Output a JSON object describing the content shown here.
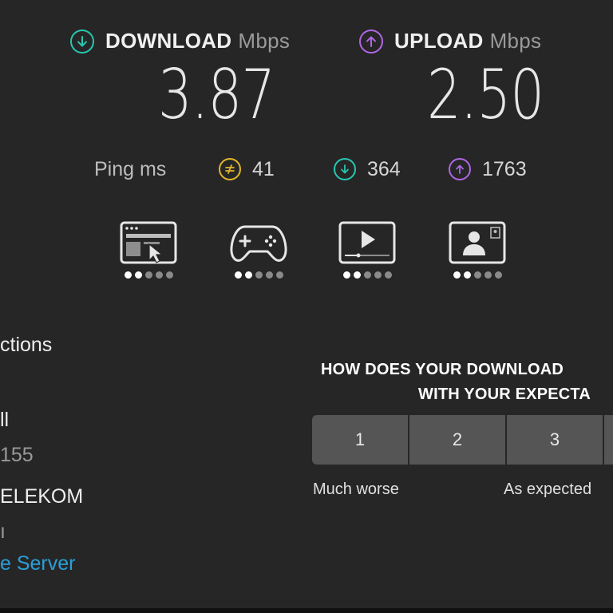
{
  "colors": {
    "download": "#27c6b0",
    "upload": "#b066e6",
    "idle": "#e2b628",
    "link": "#2a9fd8"
  },
  "download": {
    "title": "DOWNLOAD",
    "unit": "Mbps",
    "value": "3.87",
    "icon": "arrow-down-circle-icon"
  },
  "upload": {
    "title": "UPLOAD",
    "unit": "Mbps",
    "value": "2.50",
    "icon": "arrow-up-circle-icon"
  },
  "ping": {
    "label": "Ping ms",
    "idle": "41",
    "download": "364",
    "upload": "1763"
  },
  "usage": [
    {
      "name": "web-browsing",
      "icon": "browser-cursor-icon",
      "level": 2,
      "max": 5
    },
    {
      "name": "gaming",
      "icon": "gamepad-icon",
      "level": 2,
      "max": 5
    },
    {
      "name": "video-streaming",
      "icon": "video-player-icon",
      "level": 2,
      "max": 5
    },
    {
      "name": "video-chat",
      "icon": "video-call-icon",
      "level": 2,
      "max": 5
    }
  ],
  "left": {
    "connections": "ctions",
    "name": "ll",
    "id": "155",
    "isp": "ELEKOM",
    "location": "ı",
    "server": "e Server"
  },
  "survey": {
    "question_line1": "HOW DOES YOUR DOWNLOAD",
    "question_line2": "WITH YOUR EXPECTA",
    "options": [
      "1",
      "2",
      "3",
      ""
    ],
    "label_low": "Much worse",
    "label_mid": "As expected"
  }
}
